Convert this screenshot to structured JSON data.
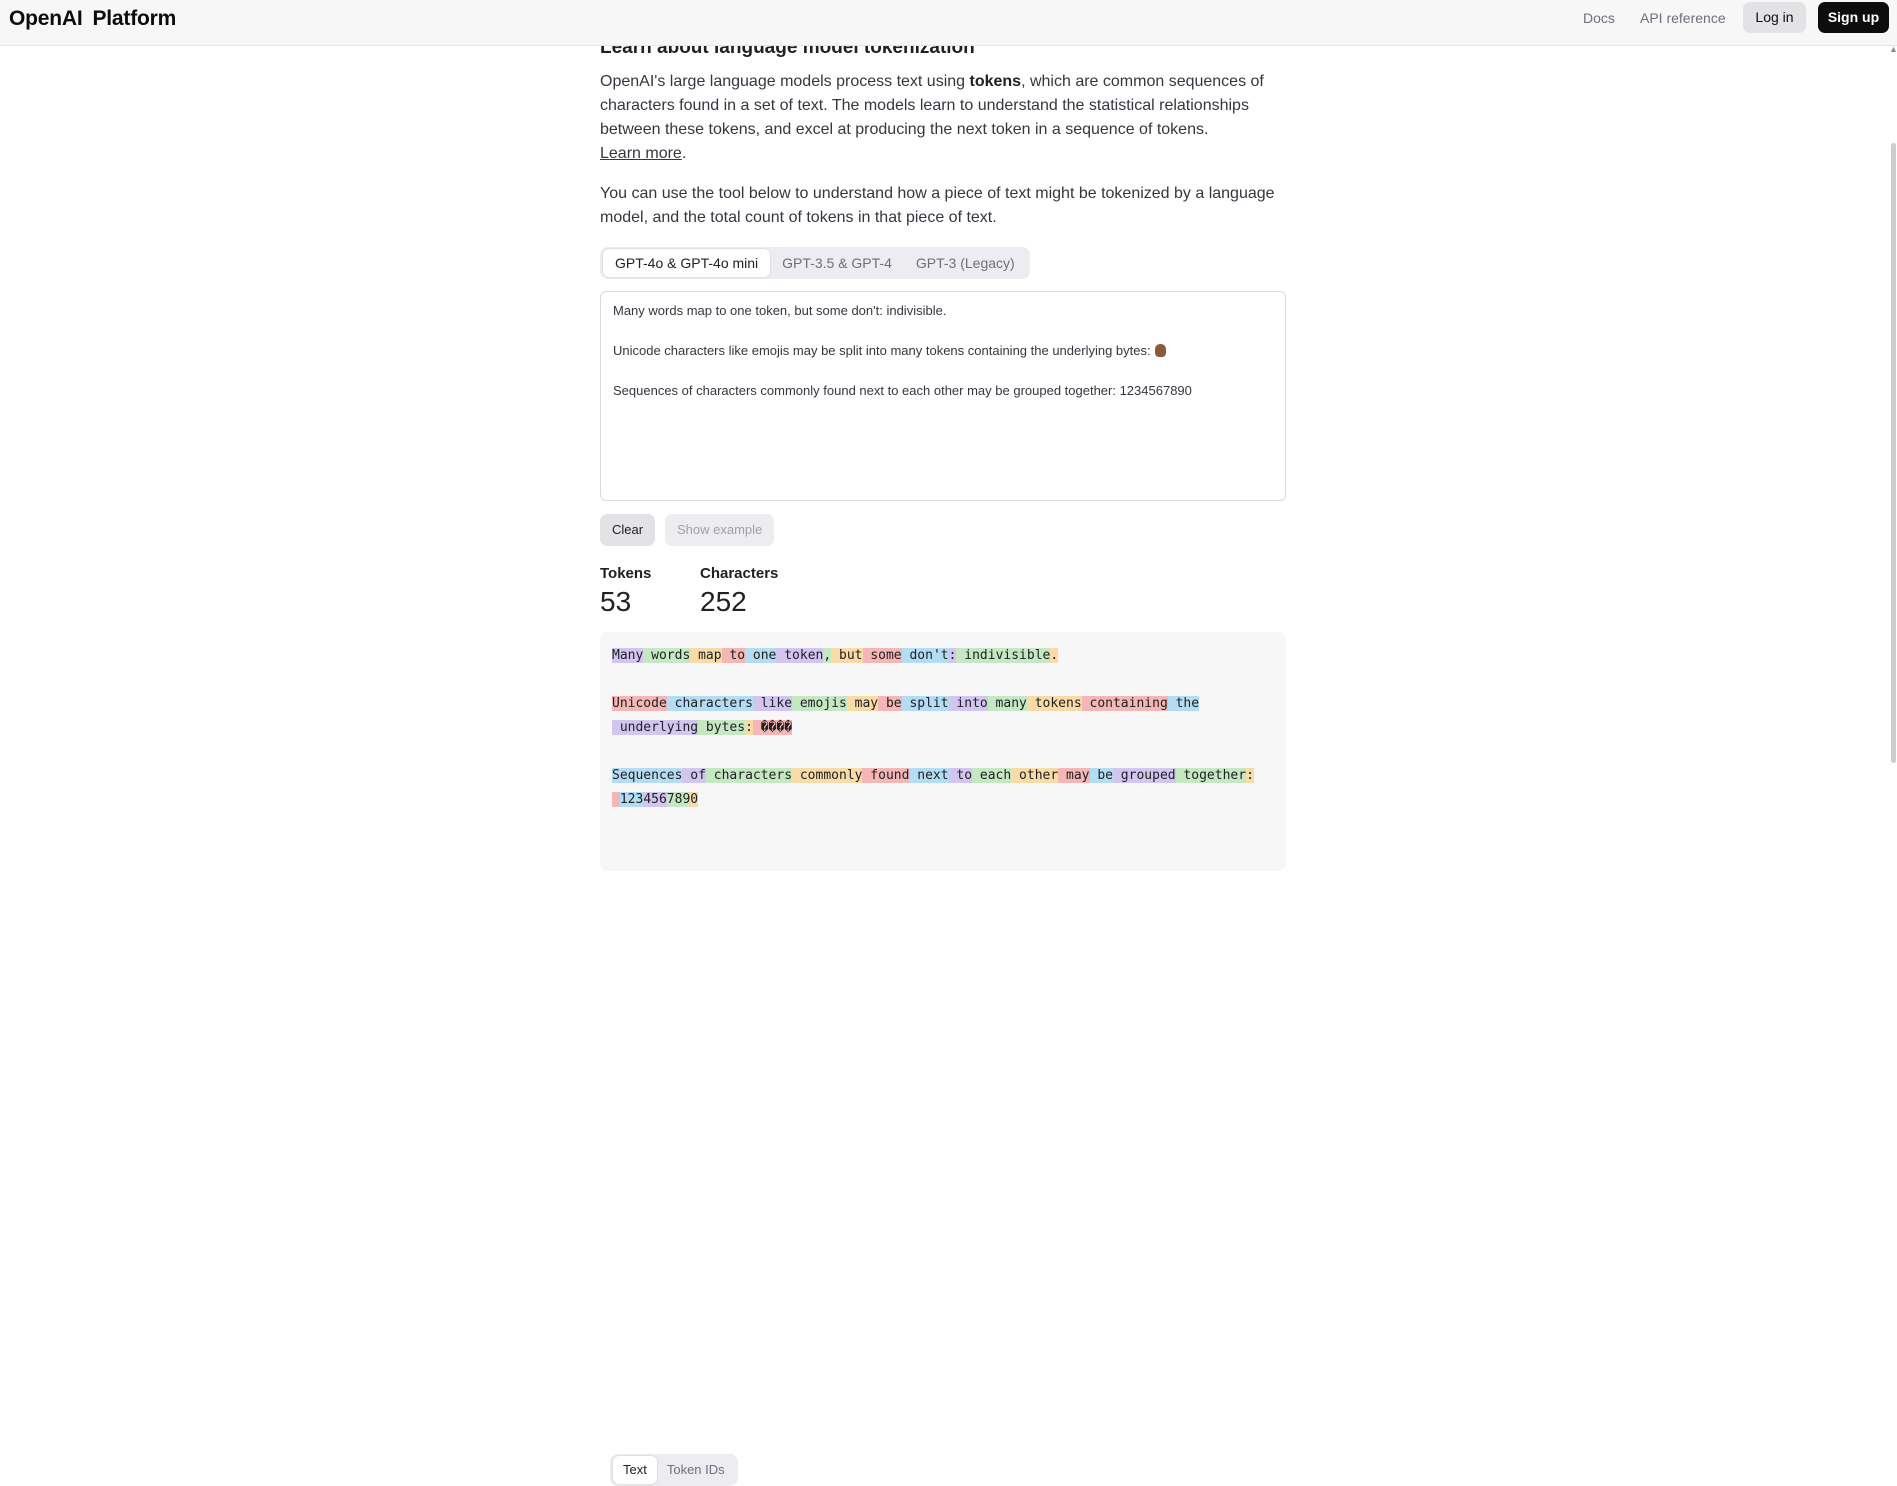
{
  "header": {
    "brand_name": "OpenAI",
    "brand_product": "Platform",
    "nav": {
      "docs": "Docs",
      "api_reference": "API reference"
    },
    "login_label": "Log in",
    "signup_label": "Sign up"
  },
  "main": {
    "title": "Learn about language model tokenization",
    "intro": {
      "before": "OpenAI's large language models process text using ",
      "bold": "tokens",
      "after": ", which are common sequences of characters found in a set of text. The models learn to understand the statistical relationships between these tokens, and excel at producing the next token in a sequence of tokens.",
      "learn_more": "Learn more",
      "period": "."
    },
    "tool_intro": "You can use the tool below to understand how a piece of text might be tokenized by a language model, and the total count of tokens in that piece of text.",
    "model_tabs": [
      "GPT-4o & GPT-4o mini",
      "GPT-3.5 & GPT-4",
      "GPT-3 (Legacy)"
    ],
    "active_tab": "GPT-4o & GPT-4o mini",
    "input_lines": [
      "Many words map to one token, but some don't: indivisible.",
      "Unicode characters like emojis may be split into many tokens containing the underlying bytes:",
      "Sequences of characters commonly found next to each other may be grouped together: 1234567890"
    ],
    "emoji_icon": "raised-hand-emoji",
    "clear_label": "Clear",
    "show_example_label": "Show example",
    "stats": {
      "tokens_label": "Tokens",
      "tokens_value": "53",
      "characters_label": "Characters",
      "characters_value": "252"
    },
    "view_tabs": [
      "Text",
      "Token IDs"
    ],
    "active_view": "Text"
  },
  "token_colors": [
    "#d2c6f1",
    "#c5e8c3",
    "#f8dba6",
    "#f5b6b6",
    "#b4dcf2"
  ],
  "token_lines": [
    [
      "Many",
      " words",
      " map",
      " to",
      " one",
      " token",
      ",",
      " but",
      " some",
      " don't",
      ":",
      " indivisible",
      "."
    ],
    [],
    [
      "Unicode",
      " characters",
      " like",
      " emojis",
      " may",
      " be",
      " split",
      " into",
      " many",
      " tokens",
      " containing",
      " the"
    ],
    [
      " underlying",
      " bytes",
      ":",
      " ����"
    ],
    [],
    [
      "Sequences",
      " of",
      " characters",
      " commonly",
      " found",
      " next",
      " to",
      " each",
      " other",
      " may",
      " be",
      " grouped",
      " together",
      ":"
    ],
    [
      " ",
      "123",
      "456",
      "789",
      "0"
    ]
  ]
}
